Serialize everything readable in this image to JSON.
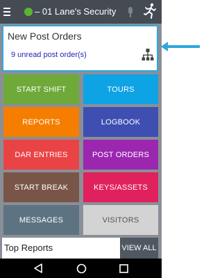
{
  "header": {
    "title": "– 01 Lane's Security",
    "status_color": "#5cb531",
    "menu_icon": "hamburger-menu-icon",
    "mic_icon": "microphone-icon",
    "runner_icon": "running-person-icon"
  },
  "alert_card": {
    "title": "New Post Orders",
    "subtitle": "9 unread post order(s)",
    "icon": "hierarchy-icon",
    "border_color": "#2ea8de"
  },
  "pointer_arrow": {
    "color": "#2ea8de"
  },
  "tiles": [
    {
      "label": "START SHIFT",
      "color": "#6ea93a"
    },
    {
      "label": "TOURS",
      "color": "#0ea3e4"
    },
    {
      "label": "REPORTS",
      "color": "#f57e00"
    },
    {
      "label": "LOGBOOK",
      "color": "#3e4fb1"
    },
    {
      "label": "DAR ENTRIES",
      "color": "#ea4346"
    },
    {
      "label": "POST ORDERS",
      "color": "#9b27b0"
    },
    {
      "label": "START BREAK",
      "color": "#795548"
    },
    {
      "label": "KEYS/ASSETS",
      "color": "#e0215d"
    },
    {
      "label": "MESSAGES",
      "color": "#5d7381"
    },
    {
      "label": "VISITORS",
      "color": "#d3d3d3",
      "text_color": "#555555"
    }
  ],
  "bottom": {
    "title": "Top Reports",
    "view_all": "VIEW ALL"
  },
  "navbar": {
    "back_icon": "back-triangle-icon",
    "home_icon": "home-circle-icon",
    "recents_icon": "recents-square-icon"
  }
}
